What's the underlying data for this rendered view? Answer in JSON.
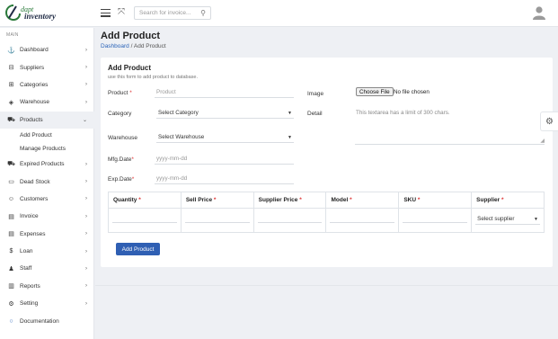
{
  "logo": {
    "line1": "dapt",
    "line2": "inventory"
  },
  "header": {
    "search_placeholder": "Search for invoice...",
    "search_icon": "search-icon",
    "expand_icon": "expand-icon"
  },
  "sidebar": {
    "section_label": "MAIN",
    "items": [
      {
        "label": "Dashboard",
        "icon": "⚓",
        "chevron": "›"
      },
      {
        "label": "Suppliers",
        "icon": "⊟",
        "chevron": "›"
      },
      {
        "label": "Categories",
        "icon": "⊞",
        "chevron": "›"
      },
      {
        "label": "Warehouse",
        "icon": "◈",
        "chevron": "›"
      },
      {
        "label": "Products",
        "icon": "⛟",
        "chevron": "⌄"
      }
    ],
    "subitems": [
      {
        "label": "Add Product"
      },
      {
        "label": "Manage Products"
      }
    ],
    "items2": [
      {
        "label": "Expired Products",
        "icon": "⛟",
        "chevron": "›"
      },
      {
        "label": "Dead Stock",
        "icon": "▭",
        "chevron": "›"
      },
      {
        "label": "Customers",
        "icon": "☺",
        "chevron": "›"
      },
      {
        "label": "Invoice",
        "icon": "▤",
        "chevron": "›"
      },
      {
        "label": "Expenses",
        "icon": "▤",
        "chevron": "›"
      },
      {
        "label": "Loan",
        "icon": "$",
        "chevron": "›"
      },
      {
        "label": "Staff",
        "icon": "♟",
        "chevron": "›"
      },
      {
        "label": "Reports",
        "icon": "▥",
        "chevron": "›"
      },
      {
        "label": "Setting",
        "icon": "⚙",
        "chevron": "›"
      },
      {
        "label": "Documentation",
        "icon": "○",
        "chevron": ""
      }
    ]
  },
  "page": {
    "title": "Add Product",
    "breadcrumb_home": "Dashboard",
    "breadcrumb_sep": "/",
    "breadcrumb_current": "Add Product"
  },
  "form": {
    "title": "Add Product",
    "subtitle": "use this form to add product to database.",
    "product_label": "Product",
    "product_placeholder": "Product",
    "category_label": "Category",
    "category_value": "Select Category",
    "warehouse_label": "Warehouse",
    "warehouse_value": "Select Warehouse",
    "mfg_label": "Mfg.Date",
    "mfg_placeholder": "yyyy-mm-dd",
    "exp_label": "Exp.Date",
    "exp_placeholder": "yyyy-mm-dd",
    "image_label": "Image",
    "choose_file": "Choose File",
    "no_file": "No file chosen",
    "detail_label": "Detail",
    "detail_placeholder": "This textarea has a limit of 300 chars.",
    "required_mark": "*",
    "caret": "▼"
  },
  "table": {
    "headers": [
      "Quantity",
      "Sell Price",
      "Supplier Price",
      "Model",
      "SKU",
      "Supplier"
    ],
    "supplier_select": "Select supplier"
  },
  "add_button": "Add Product"
}
